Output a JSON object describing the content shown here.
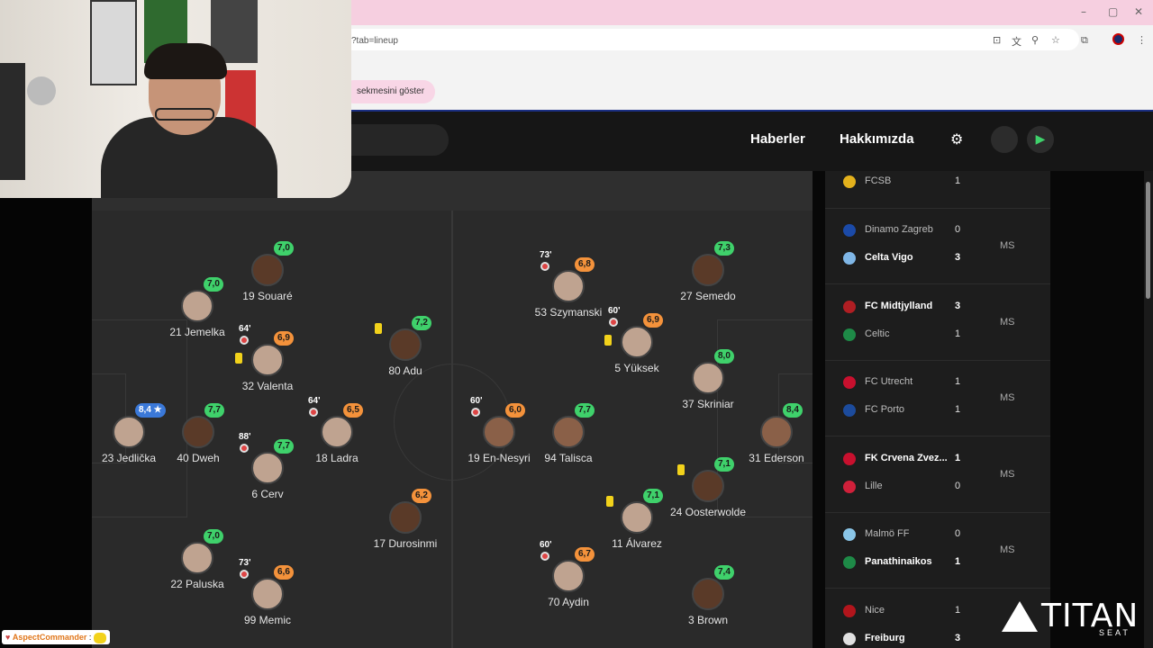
{
  "browser": {
    "window_controls": [
      "–",
      "▢",
      "✕"
    ],
    "url_fragment": "?tab=lineup",
    "toolbar_icons": [
      "install-app-icon",
      "translate-icon",
      "zoom-icon",
      "bookmark-star-icon",
      "extensions-icon",
      "profile-icon",
      "menu-icon"
    ],
    "bookmark_pill": "sekmesini göster"
  },
  "header": {
    "nav": [
      "Haberler",
      "Hakkımızda"
    ],
    "icons": [
      "gear-icon",
      "apple-icon",
      "play-store-icon"
    ]
  },
  "lineup": [
    {
      "name": "19 Souaré",
      "rating": "7,0",
      "color": "green"
    },
    {
      "name": "21 Jemelka",
      "rating": "7,0",
      "color": "green"
    },
    {
      "name": "32 Valenta",
      "rating": "6,9",
      "color": "orange",
      "sub": "64'",
      "yellow": true
    },
    {
      "name": "80 Adu",
      "rating": "7,2",
      "color": "green",
      "yellow": true
    },
    {
      "name": "23 Jedlička",
      "rating": "8,4 ★",
      "color": "blue"
    },
    {
      "name": "40 Dweh",
      "rating": "7,7",
      "color": "green"
    },
    {
      "name": "18 Ladra",
      "rating": "6,5",
      "color": "orange",
      "sub": "64'"
    },
    {
      "name": "6 Cerv",
      "rating": "7,7",
      "color": "green",
      "sub": "88'"
    },
    {
      "name": "17 Durosinmi",
      "rating": "6,2",
      "color": "orange"
    },
    {
      "name": "22 Paluska",
      "rating": "7,0",
      "color": "green"
    },
    {
      "name": "99 Memic",
      "rating": "6,6",
      "color": "orange",
      "sub": "73'"
    },
    {
      "name": "53 Szymanski",
      "rating": "6,8",
      "color": "orange",
      "sub": "73'"
    },
    {
      "name": "27 Semedo",
      "rating": "7,3",
      "color": "green"
    },
    {
      "name": "5 Yüksek",
      "rating": "6,9",
      "color": "orange",
      "sub": "60'",
      "yellow": true
    },
    {
      "name": "37 Skriniar",
      "rating": "8,0",
      "color": "green"
    },
    {
      "name": "19 En-Nesyri",
      "rating": "6,0",
      "color": "orange",
      "sub": "60'"
    },
    {
      "name": "94 Talisca",
      "rating": "7,7",
      "color": "green"
    },
    {
      "name": "31 Ederson",
      "rating": "8,4",
      "color": "green"
    },
    {
      "name": "24 Oosterwolde",
      "rating": "7,1",
      "color": "green",
      "yellow": true
    },
    {
      "name": "11 Álvarez",
      "rating": "7,1",
      "color": "green",
      "yellow": true
    },
    {
      "name": "70 Aydin",
      "rating": "6,7",
      "color": "orange",
      "sub": "60'"
    },
    {
      "name": "3 Brown",
      "rating": "7,4",
      "color": "green"
    }
  ],
  "matches": [
    {
      "home": "FCSB",
      "home_score": "1",
      "home_win": false,
      "home_logo": "#e3b11c",
      "away": "",
      "away_score": "",
      "away_logo": "",
      "status": ""
    },
    {
      "home": "Dinamo Zagreb",
      "home_score": "0",
      "home_win": false,
      "home_logo": "#1b4aa8",
      "away": "Celta Vigo",
      "away_score": "3",
      "away_win": true,
      "away_logo": "#7fb6e6",
      "status": "MS"
    },
    {
      "home": "FC Midtjylland",
      "home_score": "3",
      "home_win": true,
      "home_logo": "#b01e23",
      "away": "Celtic",
      "away_score": "1",
      "away_win": false,
      "away_logo": "#1e8a47",
      "status": "MS"
    },
    {
      "home": "FC Utrecht",
      "home_score": "1",
      "home_win": false,
      "home_logo": "#c8102e",
      "away": "FC Porto",
      "away_score": "1",
      "away_win": false,
      "away_logo": "#1c4b9c",
      "status": "MS"
    },
    {
      "home": "FK Crvena Zvez...",
      "home_score": "1",
      "home_win": true,
      "home_logo": "#c8102e",
      "away": "Lille",
      "away_score": "0",
      "away_win": false,
      "away_logo": "#d0203a",
      "status": "MS"
    },
    {
      "home": "Malmö FF",
      "home_score": "0",
      "home_win": false,
      "home_logo": "#8ac6e8",
      "away": "Panathinaikos",
      "away_score": "1",
      "away_win": true,
      "away_logo": "#1e8a47",
      "status": "MS"
    },
    {
      "home": "Nice",
      "home_score": "1",
      "home_win": false,
      "home_logo": "#b2151c",
      "away": "Freiburg",
      "away_score": "3",
      "away_win": true,
      "away_logo": "#e0e0e0",
      "status": ""
    }
  ],
  "overlay": {
    "chat_user": "AspectCommander",
    "chat_sep": ":",
    "logo_text": "TITAN",
    "logo_sub": "SEAT"
  }
}
